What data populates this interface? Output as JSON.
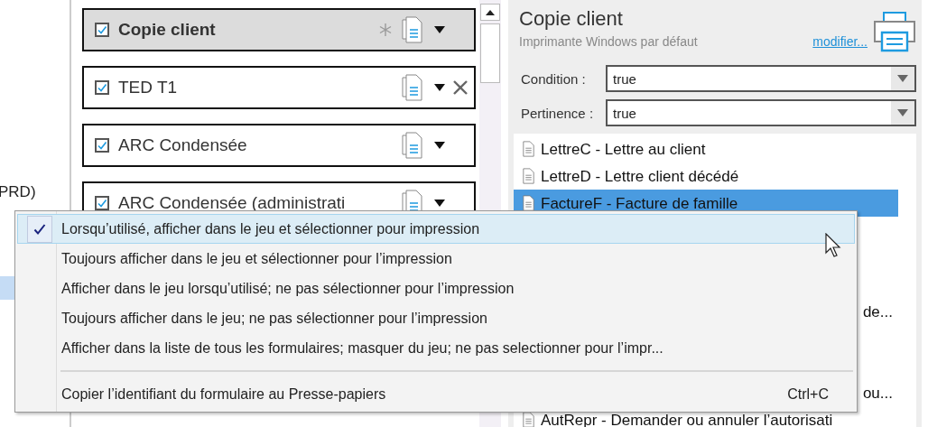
{
  "tree": {
    "items": [
      {
        "text": "PRD)",
        "selected": false
      },
      {
        "selected": true
      }
    ]
  },
  "cards": [
    {
      "label": "Copie client",
      "checked": true,
      "selected": true,
      "asterisk": true,
      "removable": false
    },
    {
      "label": "TED T1",
      "checked": true,
      "selected": false,
      "asterisk": false,
      "removable": true
    },
    {
      "label": "ARC Condensée",
      "checked": true,
      "selected": false,
      "asterisk": false,
      "removable": false
    },
    {
      "label": "ARC Condensée (administrati",
      "checked": true,
      "selected": false,
      "asterisk": false,
      "removable": false
    }
  ],
  "detail": {
    "title": "Copie client",
    "printer": "Imprimante Windows par défaut",
    "link": "modifier...",
    "fields": [
      {
        "label": "Condition :",
        "value": "true"
      },
      {
        "label": "Pertinence :",
        "value": "true"
      }
    ],
    "forms": [
      {
        "kind": "row",
        "text": "LettreC - Lettre au client",
        "selected": false
      },
      {
        "kind": "row",
        "text": "LettreD - Lettre client décédé",
        "selected": false
      },
      {
        "kind": "row",
        "text": "FactureF - Facture de famille",
        "selected": true
      },
      {
        "kind": "blank"
      },
      {
        "kind": "blank"
      },
      {
        "kind": "blank"
      },
      {
        "kind": "tail",
        "text": "de..."
      },
      {
        "kind": "blank"
      },
      {
        "kind": "blank"
      },
      {
        "kind": "tail",
        "text": "ou..."
      },
      {
        "kind": "row",
        "text": "AutRepr - Demander ou annuler l’autorisati",
        "selected": false
      }
    ]
  },
  "menu": {
    "items": [
      {
        "kind": "option",
        "text": "Lorsqu’utilisé, afficher dans le jeu et sélectionner pour impression",
        "checked": true,
        "selected": true
      },
      {
        "kind": "option",
        "text": "Toujours afficher dans le jeu et sélectionner pour l’impression",
        "checked": false,
        "selected": false
      },
      {
        "kind": "option",
        "text": "Afficher dans le jeu lorsqu’utilisé; ne pas sélectionner pour l’impression",
        "checked": false,
        "selected": false
      },
      {
        "kind": "option",
        "text": "Toujours afficher dans le jeu; ne pas sélectionner pour l’impression",
        "checked": false,
        "selected": false
      },
      {
        "kind": "option",
        "text": "Afficher dans la liste de tous les formulaires; masquer du jeu; ne pas selectionner pour l’impr...",
        "checked": false,
        "selected": false
      },
      {
        "kind": "separator"
      },
      {
        "kind": "command",
        "text": "Copier l’identifiant du formulaire au Presse-papiers",
        "shortcut": "Ctrl+C"
      }
    ]
  }
}
